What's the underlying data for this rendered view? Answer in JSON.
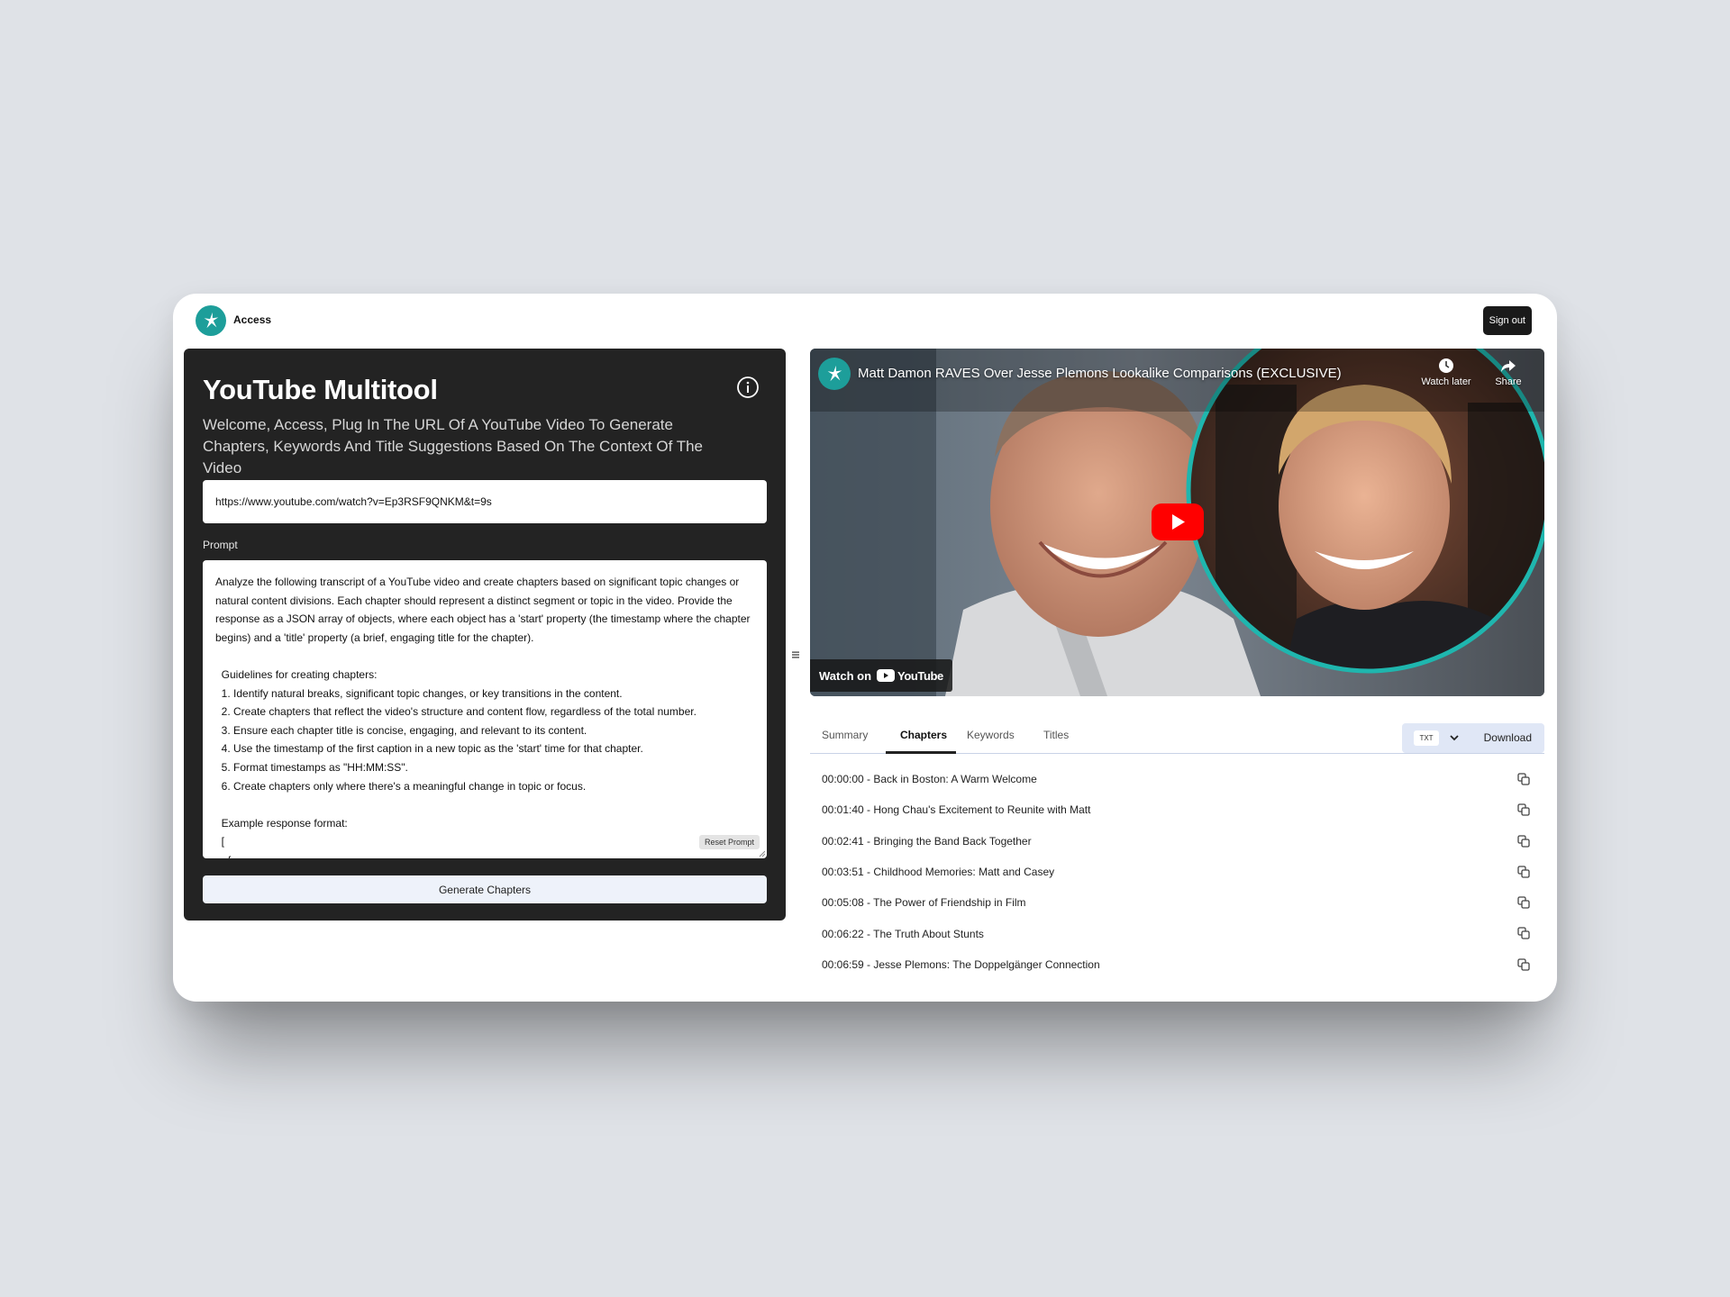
{
  "header": {
    "brand": "Access",
    "sign_out_label": "Sign out"
  },
  "tool": {
    "title": "YouTube Multitool",
    "subtitle": "Welcome, Access, Plug In The URL Of A YouTube Video To Generate Chapters, Keywords And Title Suggestions Based On The Context Of The Video",
    "url_value": "https://www.youtube.com/watch?v=Ep3RSF9QNKM&t=9s",
    "prompt_label": "Prompt",
    "prompt_text": "Analyze the following transcript of a YouTube video and create chapters based on significant topic changes or natural content divisions. Each chapter should represent a distinct segment or topic in the video. Provide the response as a JSON array of objects, where each object has a 'start' property (the timestamp where the chapter begins) and a 'title' property (a brief, engaging title for the chapter).\n\n  Guidelines for creating chapters:\n  1. Identify natural breaks, significant topic changes, or key transitions in the content.\n  2. Create chapters that reflect the video's structure and content flow, regardless of the total number.\n  3. Ensure each chapter title is concise, engaging, and relevant to its content.\n  4. Use the timestamp of the first caption in a new topic as the 'start' time for that chapter.\n  5. Format timestamps as \"HH:MM:SS\".\n  6. Create chapters only where there's a meaningful change in topic or focus.\n\n  Example response format:\n  [\n    {",
    "reset_label": "Reset Prompt",
    "generate_label": "Generate Chapters"
  },
  "video": {
    "title": "Matt Damon RAVES Over Jesse Plemons Lookalike Comparisons (EXCLUSIVE)",
    "watch_later": "Watch later",
    "share": "Share",
    "watch_on": "Watch on",
    "youtube": "YouTube"
  },
  "results": {
    "tabs": [
      "Summary",
      "Chapters",
      "Keywords",
      "Titles"
    ],
    "active_tab": "Chapters",
    "format": "TXT",
    "download_label": "Download",
    "chapters": [
      "00:00:00 - Back in Boston: A Warm Welcome",
      "00:01:40 - Hong Chau's Excitement to Reunite with Matt",
      "00:02:41 - Bringing the Band Back Together",
      "00:03:51 - Childhood Memories: Matt and Casey",
      "00:05:08 - The Power of Friendship in Film",
      "00:06:22 - The Truth About Stunts",
      "00:06:59 - Jesse Plemons: The Doppelgänger Connection"
    ]
  },
  "colors": {
    "accent": "#1d9e9a",
    "panel": "#232323",
    "youtube_red": "#ff0000"
  }
}
